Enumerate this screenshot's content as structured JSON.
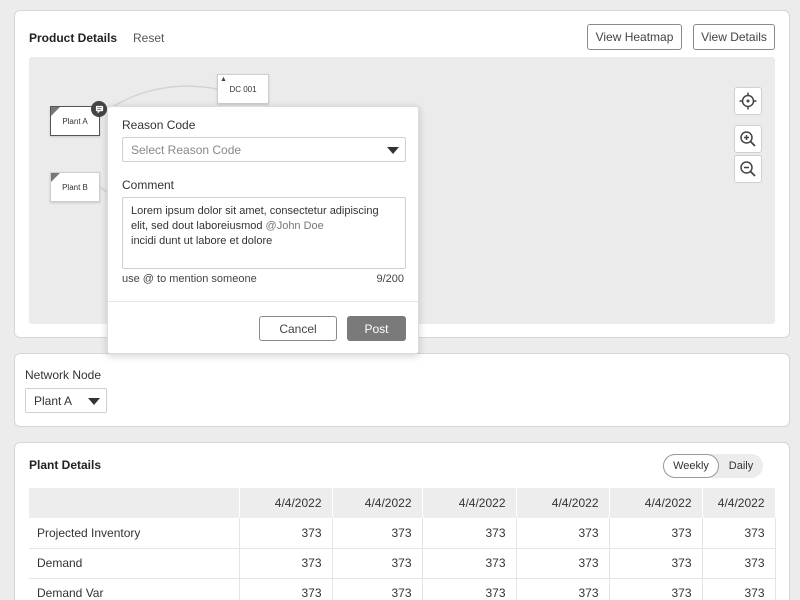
{
  "product": {
    "title": "Product Details",
    "reset": "Reset",
    "view_heatmap": "View Heatmap",
    "view_details": "View Details"
  },
  "map": {
    "nodes": [
      "Plant A",
      "Plant B",
      "DC 001"
    ]
  },
  "comment_popup": {
    "reason_label": "Reason Code",
    "reason_placeholder": "Select Reason Code",
    "comment_label": "Comment",
    "comment_line1": "Lorem ipsum dolor sit amet, consectetur adipiscing",
    "comment_line2": "elit, sed dout laboreiusmod",
    "mention": "@John Doe",
    "comment_line3": "incidi dunt ut labore et dolore",
    "hint": "use @ to mention someone",
    "counter": "9/200",
    "cancel": "Cancel",
    "post": "Post"
  },
  "network": {
    "label": "Network Node",
    "selected": "Plant A"
  },
  "plant_details": {
    "title": "Plant Details",
    "toggle": {
      "weekly": "Weekly",
      "daily": "Daily",
      "active": "Weekly"
    },
    "columns": [
      "",
      "4/4/2022",
      "4/4/2022",
      "4/4/2022",
      "4/4/2022",
      "4/4/2022",
      "4/4/2022"
    ],
    "rows": [
      {
        "label": "Projected Inventory",
        "values": [
          "373",
          "373",
          "373",
          "373",
          "373",
          "373"
        ]
      },
      {
        "label": "Demand",
        "values": [
          "373",
          "373",
          "373",
          "373",
          "373",
          "373"
        ]
      },
      {
        "label": "Demand Var",
        "values": [
          "373",
          "373",
          "373",
          "373",
          "373",
          "373"
        ]
      }
    ]
  }
}
